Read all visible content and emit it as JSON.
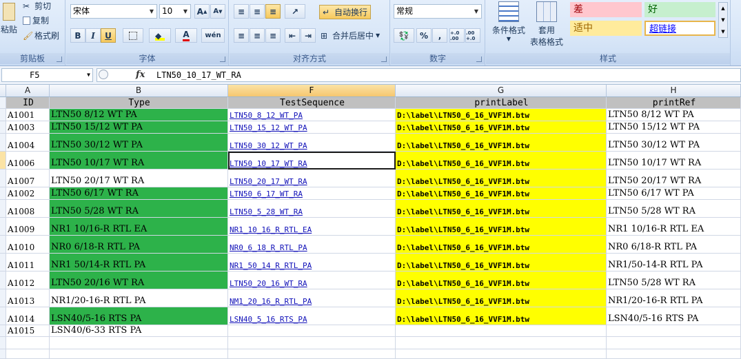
{
  "ribbon": {
    "clipboard": {
      "paste_label": "粘贴",
      "cut_label": "剪切",
      "copy_label": "复制",
      "format_painter_label": "格式刷",
      "group_label": "剪贴板"
    },
    "font": {
      "font_name": "宋体",
      "font_size": "10",
      "grow_label": "A",
      "shrink_label": "A",
      "bold_label": "B",
      "italic_label": "I",
      "underline_label": "U",
      "font_color_label": "A",
      "phonetic_label": "wén",
      "group_label": "字体"
    },
    "alignment": {
      "wrap_text_label": "自动换行",
      "merge_center_label": "合并后居中",
      "group_label": "对齐方式"
    },
    "number": {
      "format_value": "常规",
      "percent_label": "%",
      "comma_label": ",",
      "inc_decimal_label": "+.0 .00",
      "dec_decimal_label": ".00 +.0",
      "group_label": "数字"
    },
    "styles": {
      "conditional_format_label": "条件格式",
      "table_format_label_1": "套用",
      "table_format_label_2": "表格格式",
      "style_bad": "差",
      "style_good": "好",
      "style_neutral": "适中",
      "style_hyperlink": "超链接",
      "group_label": "样式"
    }
  },
  "formula_bar": {
    "name_box": "F5",
    "fx_label": "fx",
    "content": "LTN50_10_17_WT_RA"
  },
  "columns": [
    {
      "letter": "A"
    },
    {
      "letter": "B"
    },
    {
      "letter": "F"
    },
    {
      "letter": "G"
    },
    {
      "letter": "H"
    }
  ],
  "header_row": [
    "ID",
    "Type",
    "TestSequence",
    "printLabel",
    "printRef"
  ],
  "rows": [
    {
      "id": "A1001",
      "type": "LTN50 8/12 WT PA",
      "seq": "LTN50_8_12_WT_PA",
      "label": "D:\\label\\LTN50_6_16_VVF1M.btw",
      "ref": "LTN50 8/12 WT PA"
    },
    {
      "id": "A1003",
      "type": "LTN50 15/12 WT PA",
      "seq": "LTN50_15_12_WT_PA",
      "label": "D:\\label\\LTN50_6_16_VVF1M.btw",
      "ref": "LTN50 15/12 WT PA"
    },
    {
      "id": "A1004",
      "type": "LTN50 30/12 WT PA",
      "seq": "LTN50_30_12_WT_PA",
      "label": "D:\\label\\LTN50_6_16_VVF1M.btw",
      "ref": "LTN50 30/12 WT PA"
    },
    {
      "id": "A1006",
      "type": "LTN50 10/17 WT RA",
      "seq": "LTN50_10_17_WT_RA",
      "label": "D:\\label\\LTN50_6_16_VVF1M.btw",
      "ref": "LTN50 10/17 WT RA"
    },
    {
      "id": "A1007",
      "type": "LTN50 20/17 WT RA",
      "seq": "LTN50_20_17_WT_RA",
      "label": "D:\\label\\LTN50_6_16_VVF1M.btw",
      "ref": "LTN50 20/17 WT RA"
    },
    {
      "id": "A1002",
      "type": "LTN50 6/17 WT RA",
      "seq": "LTN50_6_17_WT_RA",
      "label": "D:\\label\\LTN50_6_16_VVF1M.btw",
      "ref": "LTN50 6/17 WT PA"
    },
    {
      "id": "A1008",
      "type": "LTN50 5/28 WT RA",
      "seq": "LTN50_5_28_WT_RA",
      "label": "D:\\label\\LTN50_6_16_VVF1M.btw",
      "ref": "LTN50 5/28 WT RA"
    },
    {
      "id": "A1009",
      "type": "NR1 10/16-R RTL EA",
      "seq": "NR1_10_16_R_RTL_EA",
      "label": "D:\\label\\LTN50_6_16_VVF1M.btw",
      "ref": "NR1 10/16-R RTL EA"
    },
    {
      "id": "A1010",
      "type": "NR0 6/18-R RTL PA",
      "seq": "NR0_6_18_R_RTL_PA",
      "label": "D:\\label\\LTN50_6_16_VVF1M.btw",
      "ref": "NR0 6/18-R RTL PA"
    },
    {
      "id": "A1011",
      "type": "NR1 50/14-R RTL PA",
      "seq": "NR1_50_14_R_RTL_PA",
      "label": "D:\\label\\LTN50_6_16_VVF1M.btw",
      "ref": "NR1/50-14-R RTL PA"
    },
    {
      "id": "A1012",
      "type": "LTN50 20/16 WT RA",
      "seq": "LTN50_20_16_WT_RA",
      "label": "D:\\label\\LTN50_6_16_VVF1M.btw",
      "ref": "LTN50 5/28 WT RA"
    },
    {
      "id": "A1013",
      "type": "NR1/20-16-R RTL PA",
      "seq": "NM1_20_16_R_RTL_PA",
      "label": "D:\\label\\LTN50_6_16_VVF1M.btw",
      "ref": "NR1/20-16-R RTL PA"
    },
    {
      "id": "A1014",
      "type": "LSN40/5-16 RTS PA",
      "seq": "LSN40_5_16_RTS_PA",
      "label": "D:\\label\\LTN50_6_16_VVF1M.btw",
      "ref": "LSN40/5-16 RTS PA"
    },
    {
      "id": "A1015",
      "type": "LSN40/6-33 RTS PA",
      "seq": "",
      "label": "",
      "ref": ""
    }
  ],
  "colors": {
    "green_fill": "#2db24a",
    "yellow_fill": "#ffff00",
    "header_fill": "#c0c0c0",
    "link_color": "#1010b8",
    "style_bad_bg": "#ffc7ce",
    "style_good_bg": "#c6efce",
    "style_neutral_bg": "#ffeb9c"
  }
}
